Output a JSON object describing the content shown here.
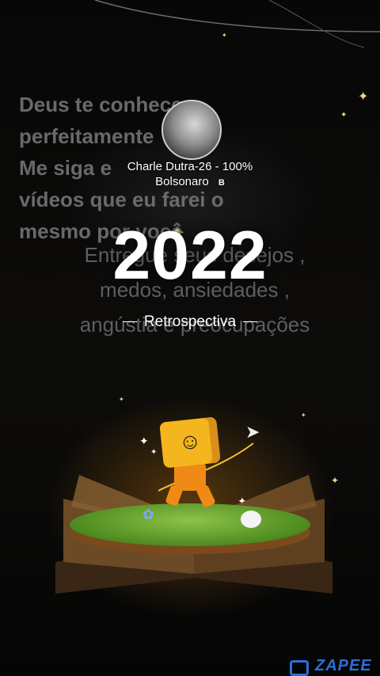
{
  "overlay": {
    "quote_text": "Deus te conhece\nperfeitamente\nMe siga e\nvídeos que eu farei o\nmesmo por você",
    "subtitle_text": "Entregue seus desejos ,\nmedos, ansiedades ,\nangústia e preocupações"
  },
  "creator": {
    "name": "Charle Dutra-26 - 100% Bolsonaro",
    "badge": "B"
  },
  "title": {
    "year": "2022",
    "label": "Retrospectiva"
  },
  "watermark": {
    "text": "ZAPEE"
  },
  "colors": {
    "background": "#0b0a08",
    "sparkle": "#f1d58a",
    "watermark": "#2a6fd6"
  },
  "icons": {
    "sparkle": "sparkle-icon",
    "paper_plane": "paper-plane-icon",
    "smiley": "smiley-face-icon"
  }
}
